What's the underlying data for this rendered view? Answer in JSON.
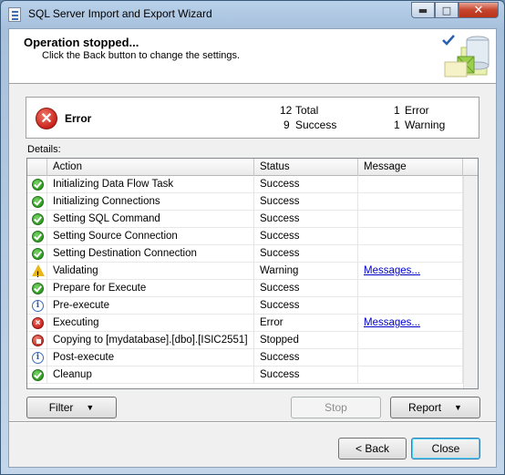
{
  "window": {
    "title": "SQL Server Import and Export Wizard",
    "minimize_glyph": "▬",
    "maximize_glyph": "□",
    "close_glyph": "✕"
  },
  "header": {
    "title": "Operation stopped...",
    "subtitle": "Click the Back button to change the settings."
  },
  "summary": {
    "label": "Error",
    "total_count": "12",
    "total_label": "Total",
    "success_count": "9",
    "success_label": "Success",
    "error_count": "1",
    "error_label": "Error",
    "warning_count": "1",
    "warning_label": "Warning"
  },
  "details_label": "Details:",
  "grid": {
    "columns": {
      "action": "Action",
      "status": "Status",
      "message": "Message"
    },
    "rows": [
      {
        "icon": "success-icon",
        "action": "Initializing Data Flow Task",
        "status": "Success",
        "message": ""
      },
      {
        "icon": "success-icon",
        "action": "Initializing Connections",
        "status": "Success",
        "message": ""
      },
      {
        "icon": "success-icon",
        "action": "Setting SQL Command",
        "status": "Success",
        "message": ""
      },
      {
        "icon": "success-icon",
        "action": "Setting Source Connection",
        "status": "Success",
        "message": ""
      },
      {
        "icon": "success-icon",
        "action": "Setting Destination Connection",
        "status": "Success",
        "message": ""
      },
      {
        "icon": "warning-icon",
        "action": "Validating",
        "status": "Warning",
        "message": "Messages..."
      },
      {
        "icon": "success-icon",
        "action": "Prepare for Execute",
        "status": "Success",
        "message": ""
      },
      {
        "icon": "info-icon",
        "action": "Pre-execute",
        "status": "Success",
        "message": ""
      },
      {
        "icon": "error-icon",
        "action": "Executing",
        "status": "Error",
        "message": "Messages..."
      },
      {
        "icon": "stopped-icon",
        "action": "Copying to [mydatabase].[dbo].[ISIC2551]",
        "status": "Stopped",
        "message": ""
      },
      {
        "icon": "info-icon",
        "action": "Post-execute",
        "status": "Success",
        "message": ""
      },
      {
        "icon": "success-icon",
        "action": "Cleanup",
        "status": "Success",
        "message": ""
      }
    ]
  },
  "buttons": {
    "filter": "Filter",
    "stop": "Stop",
    "report": "Report",
    "back": "< Back",
    "close": "Close",
    "dropdown_glyph": "▼"
  },
  "colors": {
    "link": "#0000cc",
    "error_red": "#c8231c",
    "success_green": "#2e9b22",
    "warning_yellow": "#e8b81a"
  }
}
